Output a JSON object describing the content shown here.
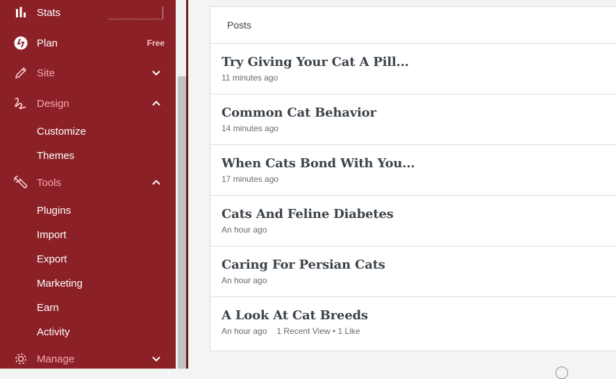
{
  "sidebar": {
    "items": [
      {
        "label": "Stats",
        "icon": "stats-icon"
      },
      {
        "label": "Plan",
        "icon": "plan-icon",
        "badge": "Free"
      },
      {
        "label": "Site",
        "icon": "pencil-icon",
        "expanded": false
      },
      {
        "label": "Design",
        "icon": "design-icon",
        "expanded": true,
        "children": [
          "Customize",
          "Themes"
        ]
      },
      {
        "label": "Tools",
        "icon": "wrench-icon",
        "expanded": true,
        "children": [
          "Plugins",
          "Import",
          "Export",
          "Marketing",
          "Earn",
          "Activity"
        ]
      },
      {
        "label": "Manage",
        "icon": "gear-icon",
        "expanded": false
      }
    ]
  },
  "posts_card": {
    "header": "Posts",
    "posts": [
      {
        "title": "Try Giving Your Cat A Pill...",
        "time": "11 minutes ago"
      },
      {
        "title": "Common Cat Behavior",
        "time": "14 minutes ago"
      },
      {
        "title": "When Cats Bond With You...",
        "time": "17 minutes ago"
      },
      {
        "title": "Cats And Feline Diabetes",
        "time": "An hour ago"
      },
      {
        "title": "Caring For Persian Cats",
        "time": "An hour ago"
      },
      {
        "title": "A Look At Cat Breeds",
        "time": "An hour ago",
        "stats": "1 Recent View • 1 Like"
      }
    ]
  },
  "colors": {
    "sidebar_bg": "#8b2126",
    "accent_pink": "#f7a8b1"
  }
}
